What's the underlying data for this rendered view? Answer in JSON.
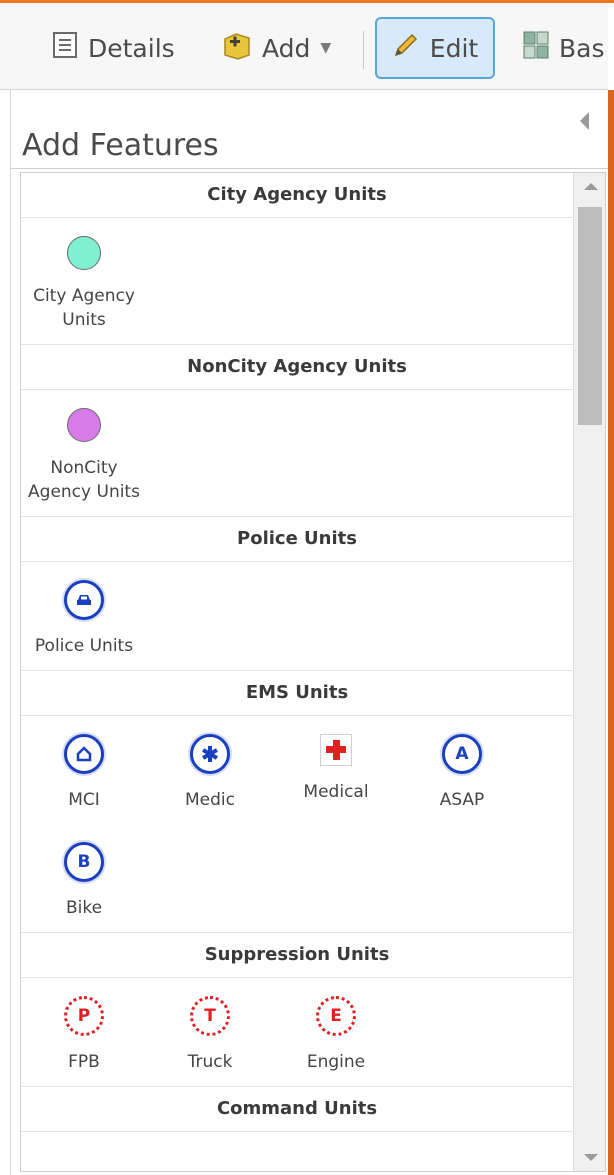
{
  "toolbar": {
    "details_label": "Details",
    "add_label": "Add",
    "edit_label": "Edit",
    "basemap_label": "Bas"
  },
  "panel": {
    "title": "Add Features"
  },
  "groups": [
    {
      "header": "City Agency Units",
      "templates": [
        {
          "label": "City Agency Units",
          "symbol": "circle",
          "color": "#7ff0d2"
        }
      ]
    },
    {
      "header": "NonCity Agency Units",
      "templates": [
        {
          "label": "NonCity Agency Units",
          "symbol": "circle",
          "color": "#d77be8"
        }
      ]
    },
    {
      "header": "Police Units",
      "templates": [
        {
          "label": "Police Units",
          "symbol": "police-car-icon",
          "color": "#1a3fbf"
        }
      ]
    },
    {
      "header": "EMS Units",
      "templates": [
        {
          "label": "MCI",
          "symbol": "house-badge-icon",
          "color": "#1a3fbf"
        },
        {
          "label": "Medic",
          "symbol": "star-of-life-icon",
          "color": "#1a3fbf"
        },
        {
          "label": "Medical",
          "symbol": "red-cross-icon",
          "color": "#e02020"
        },
        {
          "label": "ASAP",
          "symbol": "letter-badge-icon",
          "glyph": "A",
          "color": "#1a3fbf"
        },
        {
          "label": "Bike",
          "symbol": "letter-badge-icon",
          "glyph": "B",
          "color": "#1a3fbf"
        }
      ]
    },
    {
      "header": "Suppression Units",
      "templates": [
        {
          "label": "FPB",
          "symbol": "letter-badge-icon",
          "glyph": "P",
          "color": "#e02020"
        },
        {
          "label": "Truck",
          "symbol": "letter-badge-icon",
          "glyph": "T",
          "color": "#e02020"
        },
        {
          "label": "Engine",
          "symbol": "letter-badge-icon",
          "glyph": "E",
          "color": "#e02020"
        }
      ]
    },
    {
      "header": "Command Units",
      "templates": []
    }
  ]
}
